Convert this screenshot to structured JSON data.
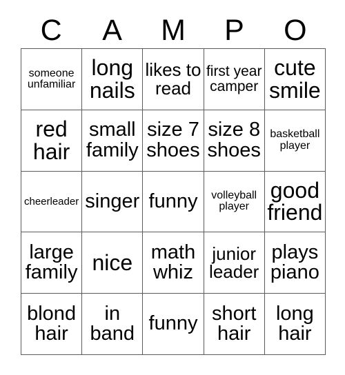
{
  "card": {
    "title_letters": [
      "C",
      "A",
      "M",
      "P",
      "O"
    ],
    "columns": 5,
    "rows": 5,
    "grid_line_color": "#5a5a5a",
    "text_color": "#000000",
    "background_color": "#ffffff",
    "cells": [
      {
        "text": "someone unfamiliar",
        "size": "xs"
      },
      {
        "text": "long nails",
        "size": "xl"
      },
      {
        "text": "likes to read",
        "size": "md"
      },
      {
        "text": "first year camper",
        "size": "sm"
      },
      {
        "text": "cute smile",
        "size": "xl"
      },
      {
        "text": "red hair",
        "size": "xl"
      },
      {
        "text": "small family",
        "size": "lg"
      },
      {
        "text": "size 7 shoes",
        "size": "lg"
      },
      {
        "text": "size 8 shoes",
        "size": "lg"
      },
      {
        "text": "basketball player",
        "size": "xs"
      },
      {
        "text": "cheerleader",
        "size": "xxs"
      },
      {
        "text": "singer",
        "size": "lg"
      },
      {
        "text": "funny",
        "size": "lg"
      },
      {
        "text": "volleyball player",
        "size": "xs"
      },
      {
        "text": "good friend",
        "size": "xl"
      },
      {
        "text": "large family",
        "size": "lg"
      },
      {
        "text": "nice",
        "size": "xl"
      },
      {
        "text": "math whiz",
        "size": "lg"
      },
      {
        "text": "junior leader",
        "size": "md"
      },
      {
        "text": "plays piano",
        "size": "lg"
      },
      {
        "text": "blond hair",
        "size": "lg"
      },
      {
        "text": "in band",
        "size": "lg"
      },
      {
        "text": "funny",
        "size": "lg"
      },
      {
        "text": "short hair",
        "size": "lg"
      },
      {
        "text": "long hair",
        "size": "lg"
      }
    ]
  }
}
